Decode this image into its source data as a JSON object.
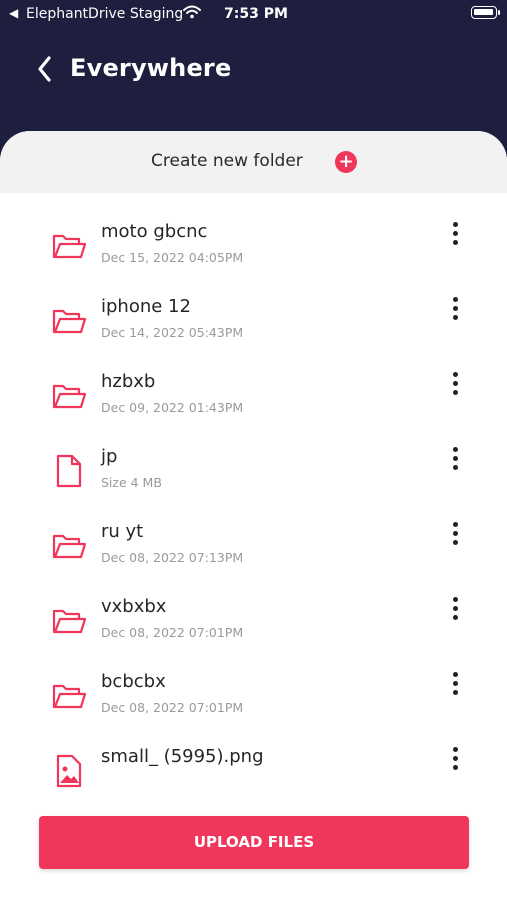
{
  "status_bar": {
    "back_indicator": "◀",
    "carrier": "ElephantDrive Staging",
    "time": "7:53 PM"
  },
  "nav": {
    "title": "Everywhere"
  },
  "create_folder": {
    "label": "Create new folder",
    "plus": "+"
  },
  "colors": {
    "header_bg": "#1e1e3f",
    "accent": "#f0365a",
    "create_row_bg": "#f2f2f3"
  },
  "files": [
    {
      "name": "moto gbcnc",
      "meta": "Dec 15, 2022 04:05PM",
      "icon": "folder-icon"
    },
    {
      "name": "iphone 12",
      "meta": "Dec 14, 2022 05:43PM",
      "icon": "folder-icon"
    },
    {
      "name": "hzbxb",
      "meta": "Dec 09, 2022 01:43PM",
      "icon": "folder-icon"
    },
    {
      "name": "jp",
      "meta": "Size 4 MB",
      "icon": "file-icon"
    },
    {
      "name": "ru yt",
      "meta": "Dec 08, 2022 07:13PM",
      "icon": "folder-icon"
    },
    {
      "name": "vxbxbx",
      "meta": "Dec 08, 2022 07:01PM",
      "icon": "folder-icon"
    },
    {
      "name": "bcbcbx",
      "meta": "Dec 08, 2022 07:01PM",
      "icon": "folder-icon"
    },
    {
      "name": "small_ (5995).png",
      "meta": "",
      "icon": "image-file-icon"
    }
  ],
  "upload_button": {
    "label": "UPLOAD FILES"
  }
}
